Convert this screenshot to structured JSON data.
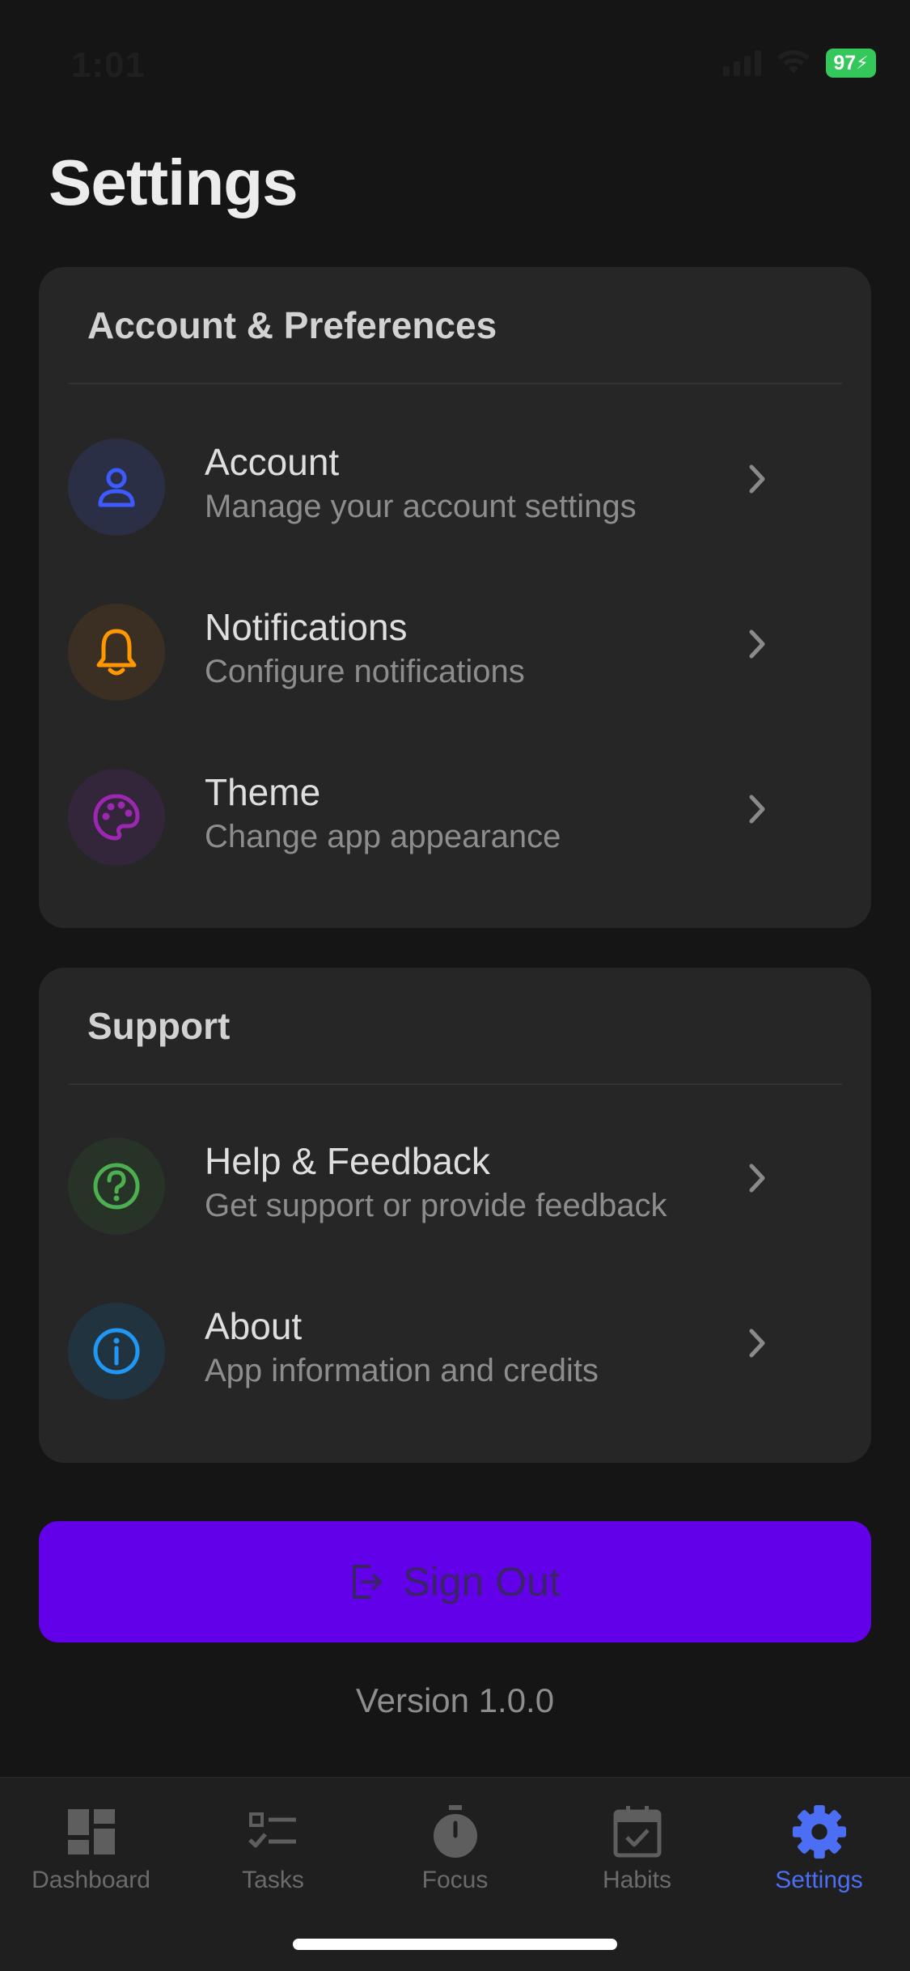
{
  "status_bar": {
    "time": "1:01",
    "battery": "97"
  },
  "page": {
    "title": "Settings"
  },
  "sections": [
    {
      "title": "Account & Preferences",
      "items": [
        {
          "title": "Account",
          "subtitle": "Manage your account settings",
          "icon": "person-icon",
          "color": "#3d5afe"
        },
        {
          "title": "Notifications",
          "subtitle": "Configure notifications",
          "icon": "bell-icon",
          "color": "#ff9800"
        },
        {
          "title": "Theme",
          "subtitle": "Change app appearance",
          "icon": "palette-icon",
          "color": "#9c27b0"
        }
      ]
    },
    {
      "title": "Support",
      "items": [
        {
          "title": "Help & Feedback",
          "subtitle": "Get support or provide feedback",
          "icon": "question-icon",
          "color": "#4caf50"
        },
        {
          "title": "About",
          "subtitle": "App information and credits",
          "icon": "info-icon",
          "color": "#2196f3"
        }
      ]
    }
  ],
  "sign_out": {
    "label": "Sign Out",
    "color": "#6200ea"
  },
  "version": "Version 1.0.0",
  "tabs": [
    {
      "label": "Dashboard",
      "icon": "dashboard-icon"
    },
    {
      "label": "Tasks",
      "icon": "tasks-icon"
    },
    {
      "label": "Focus",
      "icon": "timer-icon"
    },
    {
      "label": "Habits",
      "icon": "calendar-check-icon"
    },
    {
      "label": "Settings",
      "icon": "gear-icon",
      "active": true
    }
  ],
  "colors": {
    "accent": "#4c6ef5",
    "background": "#151515",
    "card": "#262626"
  }
}
